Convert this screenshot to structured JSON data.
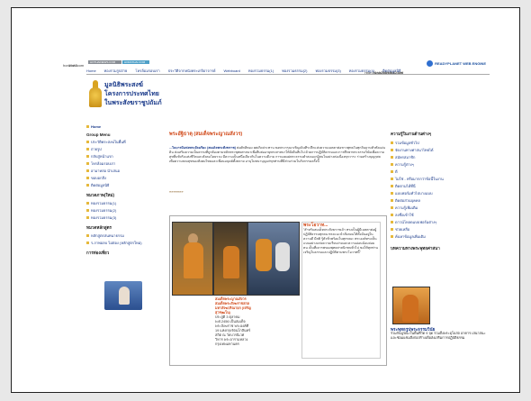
{
  "print": {
    "url_left": "horathai.com",
    "url_right": "http://www.horathai.com",
    "footer_left": "1 of 5",
    "footer_right": "11/4/2009 8:12 AM"
  },
  "topbar": {
    "btn1": "HOTHAINEWS.COM",
    "btn2": "HORATHAI.COM",
    "brand": "READYPLANET WEB ENGINE"
  },
  "nav": {
    "items": [
      "Home",
      "ทองรวมรูปถ่าย",
      "โหรล้อมรอบเรา",
      "ประวัติจากหนังพระเกจิอาจารย์",
      "Webboard",
      "ทองรวมธรรม(1)",
      "ทองรวมธรรม(2)",
      "ทองรวมธรรม(3)",
      "ทองรวมธรรม(4)",
      "ติดต่อมูลนิธิ"
    ]
  },
  "site": {
    "title_line1": "มูลนิธิพระสงฆ์",
    "title_line2": "โครงการประทศไทย",
    "title_line3": "ในพระสังฆราชูปถัมภ์"
  },
  "left": {
    "home": "Home",
    "group_menu": "Group Menu",
    "items1": [
      "ประวัติพระสงฆ์ในพื้นที่",
      "ถ่ายรูป",
      "กลับสู่หน้าแรก",
      "โหรล้อมรอบเรา",
      "อามาหล่อ นำเสนอ",
      "ขอบอกสิ่ง",
      "ติดต่อมูลนิธิ"
    ],
    "section2": "หมวดภาพ(ใหม่)",
    "items2": [
      "ทองรวมธรรม(1)",
      "ทองรวมธรรม(2)",
      "ทองรวมธรรม(3)"
    ],
    "section3": "หมวดหลักสูตร",
    "items3": [
      "หลักสูตรสนทนาธรรม",
      "ร.ภาพอลบ ไม่ต่อง (หลักสูตรใหม่)"
    ],
    "section4": "การท่องเที่ยว"
  },
  "main": {
    "section_title": "พระอัฐิธาตุ (สมเด็จพระญาณสังวร)",
    "article_lead": "...ในบารมีแห่งพระอัจฉริยะ (สมเด็จพระสังฆราช)",
    "article_body": "ต่อศักดิ์ทอง ยศเกิดประทาน ขอพระกรุณาเชิญเป็นที่ระลึกแห่งความเมตตาต่อชาวพุทธในทุกถิ่นฐานทั่วทั้งแผ่นดิน ส่งเสริมความเป็นธรรมที่ถูกต้องตามหลักพระพุทธศาสนาเพื่อสืบต่ออายุพระศาสนาให้ยั่งยืนสืบไป ด้วยการปฏิบัติธรรมและการศึกษาพระธรรมวินัยเพื่อความสุขที่แท้จริงแห่งชีวิตและสังคมโดยรวม มีความเป็นหนึ่งเดียวกันในความดีงาม การเผยแผ่พระธรรมคำสอนแก่ผู้สนใจอย่างต่อเนื่องทุกวาระ ร่วมสร้างบุญกุศลเพื่อความสงบสุขของสังคมไทยและเพื่อนมนุษย์ทั้งหลาย อานุโมทนาบุญแก่ทุกท่านที่มีส่วนร่วมในกิจกรรมครั้งนี้",
    "dots": "»»»»»»»",
    "caption_title": "สมเด็จพระญาณสังวร สมเด็จพระสังฆราชสกลมหาสังฆปริณายก (เจริญ สุวฑฺฒโน)",
    "caption_text": "ประสูติ 3 ตุลาคม พ.ศ.2456 เป็นสมเด็จพระสังฆราช พระองค์ที่ 19 แห่งกรุงรัตนโกสินทร์ สถิต ณ วัดบวรนิเวศวิหาร พระอารามหลวงกรุงเทพมหานคร",
    "quote_title": "พระโอวาท...",
    "quote_text": "\"สำหรับสมเด็จพระสังฆราชเจ้า ทรงเป็นผู้มีเมตตาต่อผู้ปฏิบัติธรรมทุกคน ทรงแนะนำสั่งสอนให้ตั้งมั่นอยู่ในความดี มีสติ รู้ตัวทั่วพร้อมในทุกขณะ พระองค์ทรงเป็นแบบอย่างแห่งความเรียบง่ายและความอ่อนน้อมถ่อมตน เป็นที่เคารพของพุทธศาสนิกชนทั่วไป ขอให้ทุกท่านเจริญในธรรมและปฏิบัติตามพระโอวาทนี้\""
  },
  "right": {
    "heading": "ความรู้ในงานด้านต่างๆ",
    "items": [
      "รวมข้อมูลทั่วไป",
      "จัดงานทางศาสนาไทยได้",
      "สมัครสมาชิก",
      "ความรู้ต่างๆ",
      "ดี",
      "ไม่ใช่ - หรือมากกว่าข้อนี้ในงาน",
      "ติดตามได้ที่นี่",
      "แบบฟอร์มทั่วไปบางแบบ",
      "ติดต่อส่วนบุคคล",
      "ความรู้เพิ่มเติม",
      "ลงชื่อเข้าใช้",
      "ดาวน์โหลดแบบฟอร์มต่างๆ",
      "ช่วยเหลือ",
      "ค้นหาข้อมูลเพิ่มเติม"
    ],
    "section2": "บทความทางพระพุทธศาสนา",
    "photo_title": "พระพุทธรูปพระธรรมวินัย",
    "photo_caption": "ร่วมกันบูรณะในพื้นที่วัด 9 จุด รวมถึงพระอุโบสถ อาคาร เสนาสนะ และซ่อมแซมสิ่งก่อสร้างเพื่อส่งเสริมการปฏิบัติธรรม"
  }
}
